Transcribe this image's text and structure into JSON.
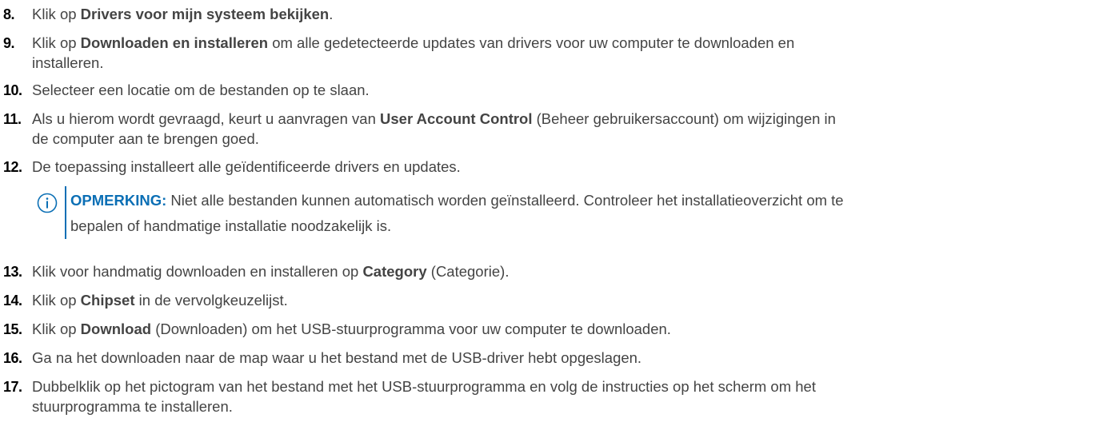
{
  "steps": [
    {
      "num": "8.",
      "parts": [
        {
          "t": "Klik op ",
          "b": false
        },
        {
          "t": "Drivers voor mijn systeem bekijken",
          "b": true
        },
        {
          "t": ".",
          "b": false
        }
      ]
    },
    {
      "num": "9.",
      "parts": [
        {
          "t": "Klik op ",
          "b": false
        },
        {
          "t": "Downloaden en installeren",
          "b": true
        },
        {
          "t": " om alle gedetecteerde updates van drivers voor uw computer te downloaden en",
          "b": false
        }
      ],
      "line2": "installeren."
    },
    {
      "num": "10.",
      "parts": [
        {
          "t": "Selecteer een locatie om de bestanden op te slaan.",
          "b": false
        }
      ]
    },
    {
      "num": "11.",
      "parts": [
        {
          "t": "Als u hierom wordt gevraagd, keurt u aanvragen van ",
          "b": false
        },
        {
          "t": "User Account Control",
          "b": true
        },
        {
          "t": " (Beheer gebruikersaccount) om wijzigingen in",
          "b": false
        }
      ],
      "line2": "de computer aan te brengen goed."
    },
    {
      "num": "12.",
      "parts": [
        {
          "t": "De toepassing installeert alle geïdentificeerde drivers en updates.",
          "b": false
        }
      ]
    },
    {
      "num": "13.",
      "parts": [
        {
          "t": "Klik voor handmatig downloaden en installeren op ",
          "b": false
        },
        {
          "t": "Category",
          "b": true
        },
        {
          "t": " (Categorie).",
          "b": false
        }
      ]
    },
    {
      "num": "14.",
      "parts": [
        {
          "t": "Klik op ",
          "b": false
        },
        {
          "t": "Chipset",
          "b": true
        },
        {
          "t": " in de vervolgkeuzelijst.",
          "b": false
        }
      ]
    },
    {
      "num": "15.",
      "parts": [
        {
          "t": "Klik op ",
          "b": false
        },
        {
          "t": "Download",
          "b": true
        },
        {
          "t": " (Downloaden) om het USB-stuurprogramma voor uw computer te downloaden.",
          "b": false
        }
      ]
    },
    {
      "num": "16.",
      "parts": [
        {
          "t": "Ga na het downloaden naar de map waar u het bestand met de USB-driver hebt opgeslagen.",
          "b": false
        }
      ]
    },
    {
      "num": "17.",
      "parts": [
        {
          "t": "Dubbelklik op het pictogram van het bestand met het USB-stuurprogramma en volg de instructies op het scherm om het",
          "b": false
        }
      ],
      "line2": "stuurprogramma te installeren."
    }
  ],
  "note": {
    "label": "OPMERKING:",
    "line1": " Niet alle bestanden kunnen automatisch worden geïnstalleerd. Controleer het installatieoverzicht om te",
    "line2": "bepalen of handmatige installatie noodzakelijk is.",
    "icon": "info-icon",
    "accent": "#0b6fb5"
  }
}
